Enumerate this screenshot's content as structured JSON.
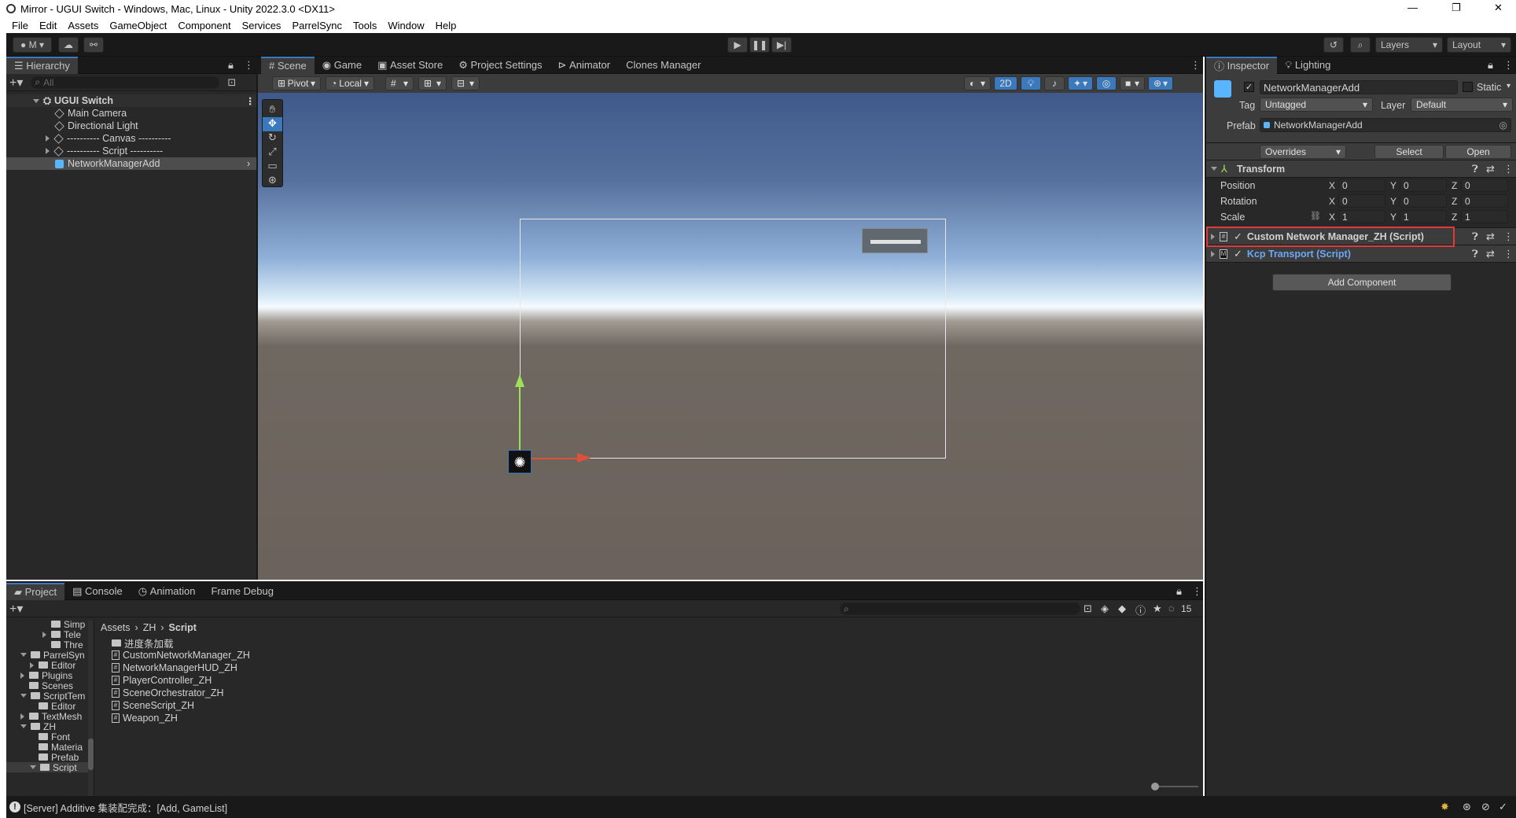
{
  "window": {
    "title": "Mirror - UGUI Switch - Windows, Mac, Linux - Unity 2022.3.0 <DX11>",
    "controls": [
      "—",
      "❐",
      "✕"
    ]
  },
  "menu": [
    "File",
    "Edit",
    "Assets",
    "GameObject",
    "Component",
    "Services",
    "ParrelSync",
    "Tools",
    "Window",
    "Help"
  ],
  "toolbar": {
    "account": "M",
    "layers": "Layers",
    "layout": "Layout"
  },
  "hierarchy": {
    "tab": "Hierarchy",
    "search_placeholder": "All",
    "scene": "UGUI Switch",
    "items": [
      "Main Camera",
      "Directional Light",
      "---------- Canvas ----------",
      "---------- Script ----------",
      "NetworkManagerAdd"
    ]
  },
  "scene_tabs": [
    "Scene",
    "Game",
    "Asset Store",
    "Project Settings",
    "Animator",
    "Clones Manager"
  ],
  "scene_toolbar": {
    "pivot": "Pivot",
    "local": "Local",
    "mode2d": "2D"
  },
  "inspector": {
    "tabs": [
      "Inspector",
      "Lighting"
    ],
    "object_name": "NetworkManagerAdd",
    "static_label": "Static",
    "tag_label": "Tag",
    "tag_value": "Untagged",
    "layer_label": "Layer",
    "layer_value": "Default",
    "prefab_label": "Prefab",
    "prefab_value": "NetworkManagerAdd",
    "overrides": "Overrides",
    "select": "Select",
    "open": "Open",
    "transform": {
      "title": "Transform",
      "rows": [
        {
          "label": "Position",
          "x": "0",
          "y": "0",
          "z": "0"
        },
        {
          "label": "Rotation",
          "x": "0",
          "y": "0",
          "z": "0"
        },
        {
          "label": "Scale",
          "x": "1",
          "y": "1",
          "z": "1"
        }
      ]
    },
    "components": [
      "Custom Network Manager_ZH (Script)",
      "Kcp Transport (Script)"
    ],
    "add_component": "Add Component",
    "highlight_color": "#e03a3a"
  },
  "bottom": {
    "tabs": [
      "Project",
      "Console",
      "Animation",
      "Frame Debug"
    ],
    "breadcrumb": [
      "Assets",
      "ZH",
      "Script"
    ],
    "count": "15",
    "tree": [
      "Simp",
      "Tele",
      "Thre",
      "ParrelSyn",
      "Editor",
      "Plugins",
      "Scenes",
      "ScriptTem",
      "Editor",
      "TextMesh",
      "ZH",
      "Font",
      "Materia",
      "Prefab",
      "Script"
    ],
    "files": [
      "进度条加载",
      "CustomNetworkManager_ZH",
      "NetworkManagerHUD_ZH",
      "PlayerController_ZH",
      "SceneOrchestrator_ZH",
      "SceneScript_ZH",
      "Weapon_ZH"
    ]
  },
  "status": {
    "text": "[Server] Additive 集装配完成：[Add, GameList]"
  }
}
